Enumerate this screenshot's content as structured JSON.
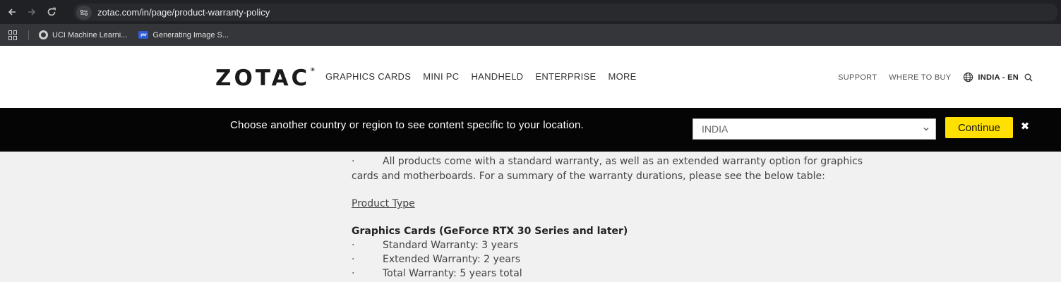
{
  "browser": {
    "url": "zotac.com/in/page/product-warranty-policy",
    "bookmarks": [
      {
        "label": "UCI Machine Learni..."
      },
      {
        "label": "Generating Image S..."
      }
    ]
  },
  "header": {
    "logo": "ZOTAC",
    "logo_mark": "®",
    "nav": [
      "GRAPHICS CARDS",
      "MINI PC",
      "HANDHELD",
      "ENTERPRISE",
      "MORE"
    ],
    "support": "SUPPORT",
    "where_to_buy": "WHERE TO BUY",
    "region": "INDIA - EN"
  },
  "region_banner": {
    "message": "Choose another country or region to see content specific to your location.",
    "selected_country": "INDIA",
    "continue_label": "Continue",
    "close_glyph": "✖"
  },
  "content": {
    "bullet": "·",
    "para_line1": "All products come with a standard warranty, as well as an extended warranty option for graphics",
    "para_line2": "cards and motherboards. For a summary of the warranty durations, please see the below table:",
    "product_type_heading": "Product Type",
    "category_title": "Graphics Cards (GeForce RTX 30 Series and later)",
    "items": [
      "Standard Warranty: 3 years",
      "Extended Warranty: 2 years",
      "Total Warranty: 5 years total"
    ]
  },
  "colors": {
    "banner_bg": "#050505",
    "continue_button": "#ffe000",
    "page_bg": "#f1f1f1"
  }
}
